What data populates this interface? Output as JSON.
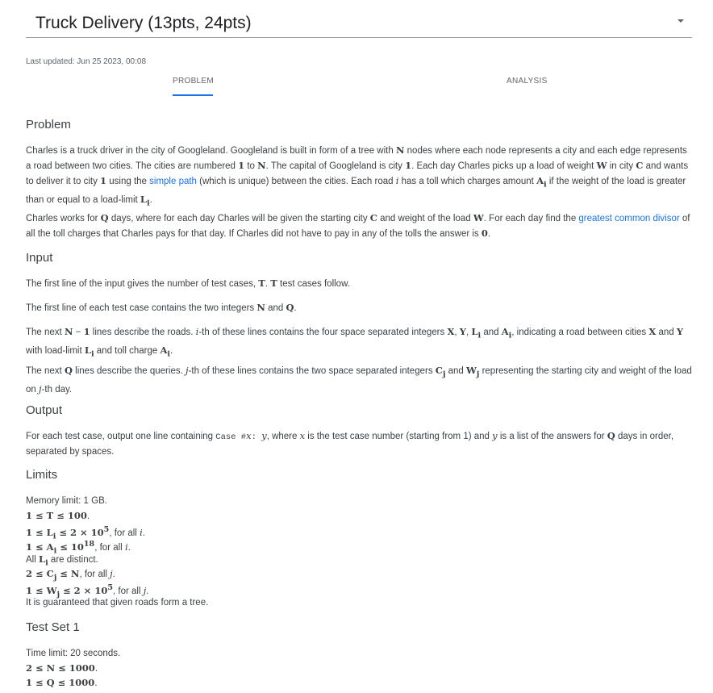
{
  "header": {
    "title": "Truck Delivery (13pts, 24pts)",
    "last_updated": "Last updated: Jun 25 2023, 00:08"
  },
  "tabs": [
    {
      "label": "PROBLEM"
    },
    {
      "label": "ANALYSIS"
    }
  ],
  "sections": {
    "problem": "Problem",
    "input": "Input",
    "output": "Output",
    "limits": "Limits",
    "testset1": "Test Set 1"
  },
  "links": {
    "simple_path": "simple path",
    "gcd": "greatest common divisor"
  },
  "limits": {
    "memory": "Memory limit: 1 GB.",
    "distinct_prefix": "All",
    "distinct_suffix": "are distinct.",
    "tree": "It is guaranteed that given roads form a tree."
  },
  "testset1": {
    "time": "Time limit: 20 seconds."
  },
  "colors": {
    "link": "#1a73e8",
    "tab_ink": "#1a73e8",
    "text": "#3c4043"
  }
}
